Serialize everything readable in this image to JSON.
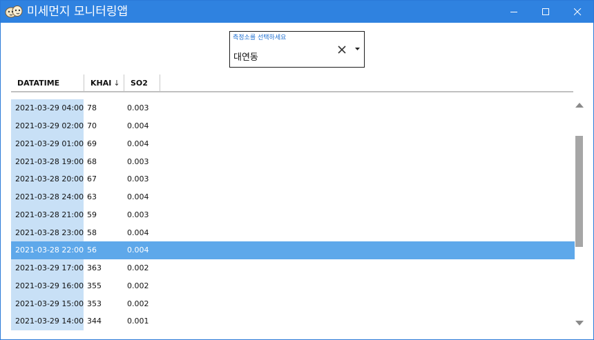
{
  "window": {
    "title": "미세먼지 모니터링앱",
    "icon": "dust-mascot-icon",
    "colors": {
      "titlebar": "#2f82e0",
      "selected_row": "#5ea8ea",
      "date_cell": "#c8e0f6"
    }
  },
  "station_combo": {
    "label": "측정소를 선택하세요",
    "value": "대연동"
  },
  "table": {
    "columns": [
      {
        "label": "DATATIME"
      },
      {
        "label": "KHAI",
        "sort": "descending"
      },
      {
        "label": "SO2"
      }
    ],
    "selected_index": 8,
    "rows": [
      {
        "datatime": "2021-03-29 04:00",
        "khai": "78",
        "so2": "0.003"
      },
      {
        "datatime": "2021-03-29 02:00",
        "khai": "70",
        "so2": "0.004"
      },
      {
        "datatime": "2021-03-29 01:00",
        "khai": "69",
        "so2": "0.004"
      },
      {
        "datatime": "2021-03-28 19:00",
        "khai": "68",
        "so2": "0.003"
      },
      {
        "datatime": "2021-03-28 20:00",
        "khai": "67",
        "so2": "0.003"
      },
      {
        "datatime": "2021-03-28 24:00",
        "khai": "63",
        "so2": "0.004"
      },
      {
        "datatime": "2021-03-28 21:00",
        "khai": "59",
        "so2": "0.003"
      },
      {
        "datatime": "2021-03-28 23:00",
        "khai": "58",
        "so2": "0.004"
      },
      {
        "datatime": "2021-03-28 22:00",
        "khai": "56",
        "so2": "0.004"
      },
      {
        "datatime": "2021-03-29 17:00",
        "khai": "363",
        "so2": "0.002"
      },
      {
        "datatime": "2021-03-29 16:00",
        "khai": "355",
        "so2": "0.002"
      },
      {
        "datatime": "2021-03-29 15:00",
        "khai": "353",
        "so2": "0.002"
      },
      {
        "datatime": "2021-03-29 14:00",
        "khai": "344",
        "so2": "0.001"
      }
    ]
  }
}
